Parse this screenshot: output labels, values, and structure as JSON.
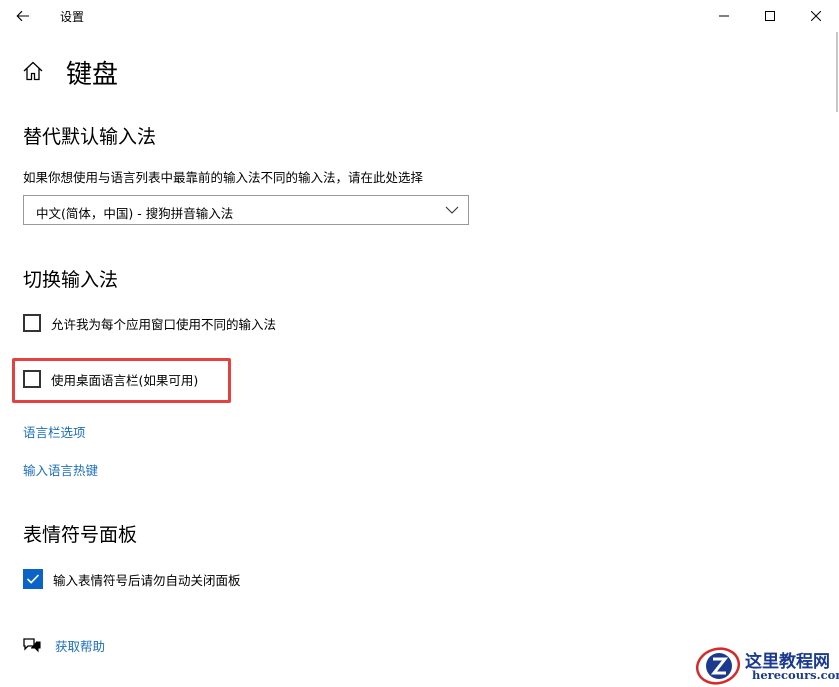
{
  "window": {
    "title": "设置"
  },
  "page": {
    "title": "键盘"
  },
  "sections": {
    "default_ime": {
      "heading": "替代默认输入法",
      "description": "如果你想使用与语言列表中最靠前的输入法不同的输入法，请在此处选择",
      "dropdown_value": "中文(简体，中国) - 搜狗拼音输入法"
    },
    "switch_ime": {
      "heading": "切换输入法",
      "options": [
        {
          "label": "允许我为每个应用窗口使用不同的输入法",
          "checked": false
        },
        {
          "label": "使用桌面语言栏(如果可用)",
          "checked": false
        }
      ],
      "links": [
        "语言栏选项",
        "输入语言热键"
      ]
    },
    "emoji_panel": {
      "heading": "表情符号面板",
      "option": {
        "label": "输入表情符号后请勿自动关闭面板",
        "checked": true
      }
    }
  },
  "help": {
    "label": "获取帮助"
  },
  "watermark": {
    "title": "这里教程网",
    "url": "herecours.com"
  },
  "colors": {
    "accent": "#0a64c8",
    "link": "#1a6fbf",
    "highlight": "#e5413f"
  }
}
